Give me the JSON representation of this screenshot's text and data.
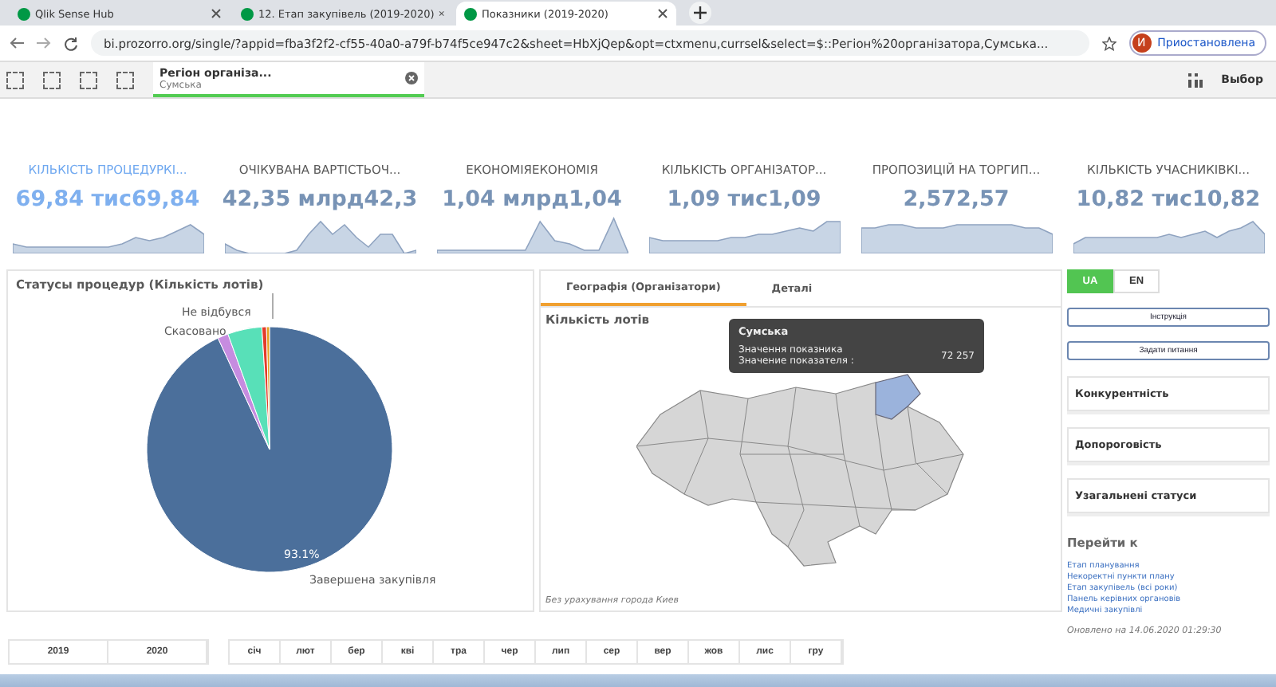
{
  "browser": {
    "tabs": [
      {
        "label": "Qlik Sense Hub",
        "selected": false
      },
      {
        "label": "12. Етап закупівель (2019-2020)",
        "selected": false
      },
      {
        "label": "Показники (2019-2020)",
        "selected": true
      }
    ],
    "url": "bi.prozorro.org/single/?appid=fba3f2f2-cf55-40a0-a79f-b74f5ce947c2&sheet=HbXjQep&opt=ctxmenu,currsel&select=$::Регіон%20організатора,Сумська...",
    "profile_initial": "И",
    "profile_label": "Приостановлена"
  },
  "toolbar": {
    "selection": {
      "field": "Регіон організа...",
      "value": "Сумська"
    },
    "selections_label": "Выбор"
  },
  "kpis": [
    {
      "title": "КІЛЬКІСТЬ ПРОЦЕДУРКІ...",
      "value": "69,84 тис69,84",
      "selected": true
    },
    {
      "title": "ОЧІКУВАНА ВАРТІСТЬОЧ...",
      "value": "42,35 млрд42,3",
      "selected": false
    },
    {
      "title": "ЕКОНОМІЯЕКОНОМІЯ",
      "value": "1,04 млрд1,04",
      "selected": false
    },
    {
      "title": "КІЛЬКІСТЬ ОРГАНІЗАТОР...",
      "value": "1,09 тис1,09",
      "selected": false
    },
    {
      "title": "ПРОПОЗИЦІЙ НА ТОРГИП...",
      "value": "2,572,57",
      "selected": false
    },
    {
      "title": "КІЛЬКІСТЬ УЧАСНИКІВКІ...",
      "value": "10,82 тис10,82",
      "selected": false
    }
  ],
  "status_panel": {
    "title": "Статусы процедур (Кількість лотів)",
    "labels": [
      "Не відбувся",
      "Скасовано",
      "Завершена закупівля"
    ],
    "slice_label": "93.1%"
  },
  "map_panel": {
    "tabs": [
      {
        "label": "Географія (Організатори)",
        "selected": true
      },
      {
        "label": "Деталі",
        "selected": false
      }
    ],
    "title": "Кількість лотів",
    "tooltip": {
      "title": "Сумська",
      "line_1": "Значення показника",
      "line_2": "Значение показателя :",
      "value": "72 257"
    },
    "footnote": "Без урахування города Киев"
  },
  "language": [
    {
      "label": "UA",
      "selected": true
    },
    {
      "label": "EN",
      "selected": false
    }
  ],
  "buttons": [
    "Інструкція",
    "Задати питання"
  ],
  "sections": [
    "Конкурентність",
    "Допороговість",
    "Узагальнені статуси"
  ],
  "goto": {
    "title": "Перейти к",
    "links": [
      "Етап планування",
      "Некоректні пункти плану",
      "Етап закупівель (всі роки)",
      "Панель керівних органовів",
      "Медичні закупівлі"
    ]
  },
  "updated": "Оновлено на 14.06.2020 01:29:30",
  "years": [
    "2019",
    "2020"
  ],
  "months": [
    "січ",
    "лют",
    "бер",
    "кві",
    "тра",
    "чер",
    "лип",
    "сер",
    "вер",
    "жов",
    "лис",
    "гру"
  ]
}
